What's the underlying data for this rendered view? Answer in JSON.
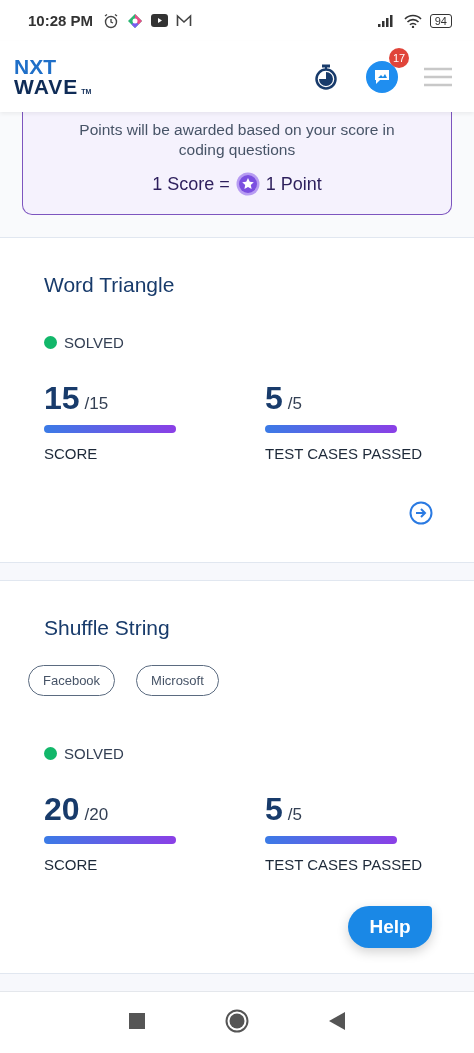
{
  "status_bar": {
    "time": "10:28 PM",
    "battery": "94"
  },
  "header": {
    "logo_top": "NXT",
    "logo_bottom": "WAVE",
    "logo_mark": "TM",
    "notification_count": "17"
  },
  "points_info": {
    "text": "Points will be awarded based on your score in coding questions",
    "score_left": "1 Score =",
    "score_right": "1 Point"
  },
  "problems": [
    {
      "title": "Word Triangle",
      "status": {
        "label": "SOLVED",
        "color": "#12b76a"
      },
      "score": {
        "value": "15",
        "total": "/15",
        "label": "SCORE"
      },
      "test_cases": {
        "value": "5",
        "total": "/5",
        "label": "TEST CASES PASSED"
      },
      "open_arrow": true
    },
    {
      "title": "Shuffle String",
      "tags": [
        "Facebook",
        "Microsoft"
      ],
      "status": {
        "label": "SOLVED",
        "color": "#12b76a"
      },
      "score": {
        "value": "20",
        "total": "/20",
        "label": "SCORE"
      },
      "test_cases": {
        "value": "5",
        "total": "/5",
        "label": "TEST CASES PASSED"
      },
      "open_arrow": false
    }
  ],
  "help_button": "Help"
}
